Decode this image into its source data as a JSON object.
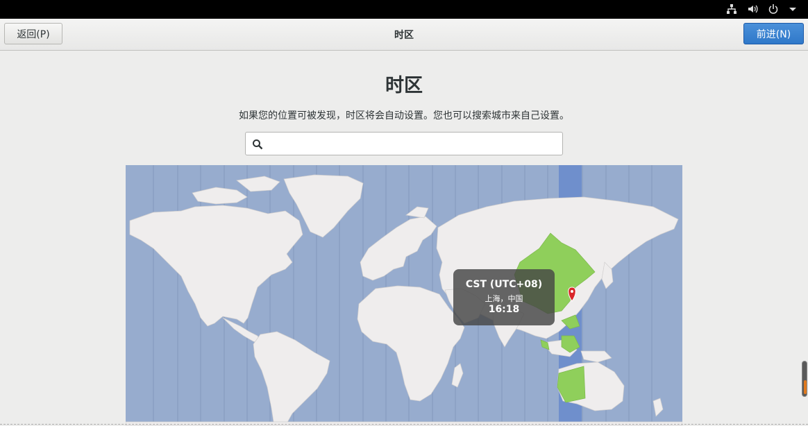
{
  "header": {
    "title": "时区",
    "back_label": "返回(P)",
    "next_label": "前进(N)"
  },
  "main": {
    "title": "时区",
    "subtitle": "如果您的位置可被发现，时区将会自动设置。您也可以搜索城市来自己设置。",
    "search": {
      "value": "",
      "placeholder": "",
      "icon": "search-icon"
    }
  },
  "map": {
    "selected_timezone": {
      "abbr": "CST (UTC+08)",
      "city": "上海，中国",
      "time": "16:18"
    },
    "colors": {
      "ocean": "#97acce",
      "land": "#efeded",
      "selected_zone_land": "#8fcf5b",
      "selected_zone_band": "#6f8fcc",
      "pin": "#d9262a"
    }
  },
  "system_tray": {
    "icons": [
      "network-icon",
      "volume-icon",
      "power-icon",
      "chevron-down-icon"
    ]
  }
}
